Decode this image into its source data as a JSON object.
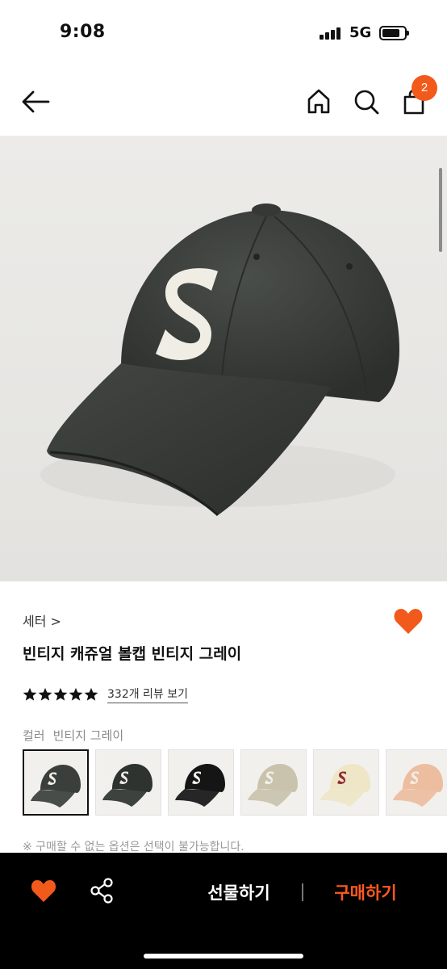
{
  "status_bar": {
    "time": "9:08",
    "network": "5G",
    "battery_level": 0.8
  },
  "nav": {
    "back_icon": "arrow-left-icon",
    "home_icon": "home-icon",
    "search_icon": "search-icon",
    "bag_icon": "shopping-bag-icon",
    "cart_count": "2"
  },
  "product": {
    "brand": "세터 >",
    "title": "빈티지 캐쥬얼 볼캡 빈티지 그레이",
    "rating": 5,
    "review_link": "332개 리뷰 보기",
    "color_label": "컬러",
    "color_value": "빈티지 그레이",
    "swatches": [
      {
        "cap": "#3b3f3b",
        "logo": "#f1efe6",
        "bg": "#f1f0ed"
      },
      {
        "cap": "#2e3330",
        "logo": "#ecebe4",
        "bg": "#f1f0ed"
      },
      {
        "cap": "#151515",
        "logo": "#f2f2ee",
        "bg": "#f1f0ed"
      },
      {
        "cap": "#c9c3ad",
        "logo": "#f3f1ea",
        "bg": "#f1f0ed"
      },
      {
        "cap": "#efe6c7",
        "logo": "#8f2a33",
        "bg": "#f1f0ed"
      },
      {
        "cap": "#edbd9f",
        "logo": "#f5ede6",
        "bg": "#f1f0ed"
      }
    ],
    "notice": "※ 구매할 수 없는 옵션은 선택이 불가능합니다."
  },
  "bottom_bar": {
    "gift_label": "선물하기",
    "buy_label": "구매하기"
  },
  "colors": {
    "accent": "#f25a1b",
    "buy_text": "#ff5a1f",
    "bottom_bar_bg": "#000000"
  }
}
